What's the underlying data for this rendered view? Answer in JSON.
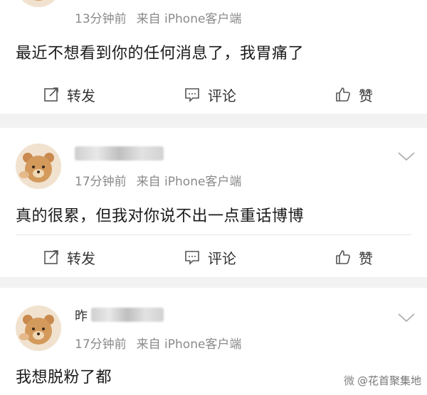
{
  "posts": [
    {
      "time": "13分钟前",
      "source": "来自 iPhone客户端",
      "content": "最近不想看到你的任何消息了，我胃痛了",
      "actions": {
        "repost": "转发",
        "comment": "评论",
        "like": "赞"
      }
    },
    {
      "time": "17分钟前",
      "source": "来自 iPhone客户端",
      "content": "真的很累，但我对你说不出一点重话博博",
      "actions": {
        "repost": "转发",
        "comment": "评论",
        "like": "赞"
      }
    },
    {
      "name_prefix": "昨",
      "time": "17分钟前",
      "source": "来自 iPhone客户端",
      "content": "我想脱粉了都"
    }
  ],
  "watermark": {
    "logo": "微",
    "text": "@花首聚集地"
  },
  "icons": [
    "bear-avatar",
    "repost-icon",
    "comment-icon",
    "like-icon",
    "chevron-down-icon",
    "weibo-logo-icon"
  ]
}
